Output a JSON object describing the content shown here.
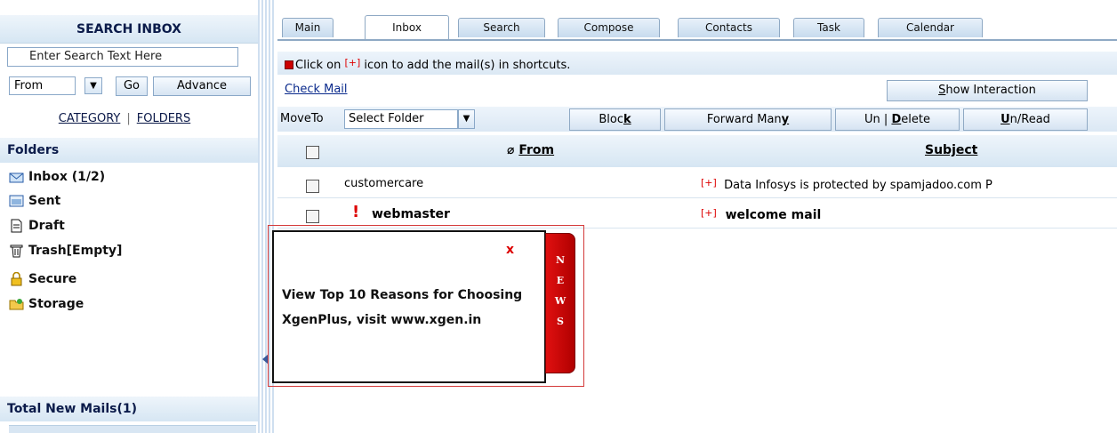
{
  "sidebar": {
    "title": "SEARCH INBOX",
    "search_placeholder": "Enter Search Text Here",
    "field_select": "From",
    "go_label": "Go",
    "advance_label": "Advance",
    "category_label": "CATEGORY",
    "folders_link_label": "FOLDERS",
    "folders_header": "Folders",
    "folders": [
      {
        "label": "Inbox",
        "count": "(1/2)",
        "icon": "inbox-icon"
      },
      {
        "label": "Sent",
        "count": "",
        "icon": "sent-icon"
      },
      {
        "label": "Draft",
        "count": "",
        "icon": "draft-icon"
      },
      {
        "label": "Trash[Empty]",
        "count": "",
        "icon": "trash-icon"
      },
      {
        "label": "Secure",
        "count": "",
        "icon": "lock-icon"
      },
      {
        "label": "Storage",
        "count": "",
        "icon": "storage-folder-icon"
      }
    ],
    "total_new": "Total New Mails(1)"
  },
  "tabs": [
    {
      "label": "Main",
      "active": false
    },
    {
      "label": "Inbox",
      "active": true
    },
    {
      "label": "Search",
      "active": false
    },
    {
      "label": "Compose",
      "active": false
    },
    {
      "label": "Contacts",
      "active": false
    },
    {
      "label": "Task",
      "active": false
    },
    {
      "label": "Calendar",
      "active": false
    }
  ],
  "info": {
    "prefix": "Click on ",
    "plus": "[+]",
    "suffix": " icon to add the mail(s) in shortcuts."
  },
  "actions": {
    "check_mail": "Check Mail",
    "show_interaction_key": "S",
    "show_interaction_rest": "how Interaction",
    "move_to": "MoveTo",
    "select_folder": "Select Folder",
    "block_prefix": "Bloc",
    "block_key": "k",
    "forward_prefix": "Forward Man",
    "forward_key": "y",
    "undelete_prefix": "Un | ",
    "undelete_key": "D",
    "undelete_rest": "elete",
    "unread_key": "U",
    "unread_rest": "n/Read"
  },
  "table": {
    "col_from": "From",
    "col_subject": "Subject",
    "rows": [
      {
        "from": "customercare",
        "plus": "[+]",
        "subject": "Data Infosys is protected by spamjadoo.com P",
        "important": false
      },
      {
        "from": "webmaster",
        "plus": "[+]",
        "subject": "welcome mail",
        "important": true
      }
    ]
  },
  "news": {
    "close": "x",
    "text": "View Top 10 Reasons for Choosing XgenPlus, visit www.xgen.in",
    "tab_label": "NEWS"
  },
  "colors": {
    "accent_red": "#cc0000",
    "header_blue": "#d6e6f3",
    "link_blue": "#0a2a8c"
  }
}
